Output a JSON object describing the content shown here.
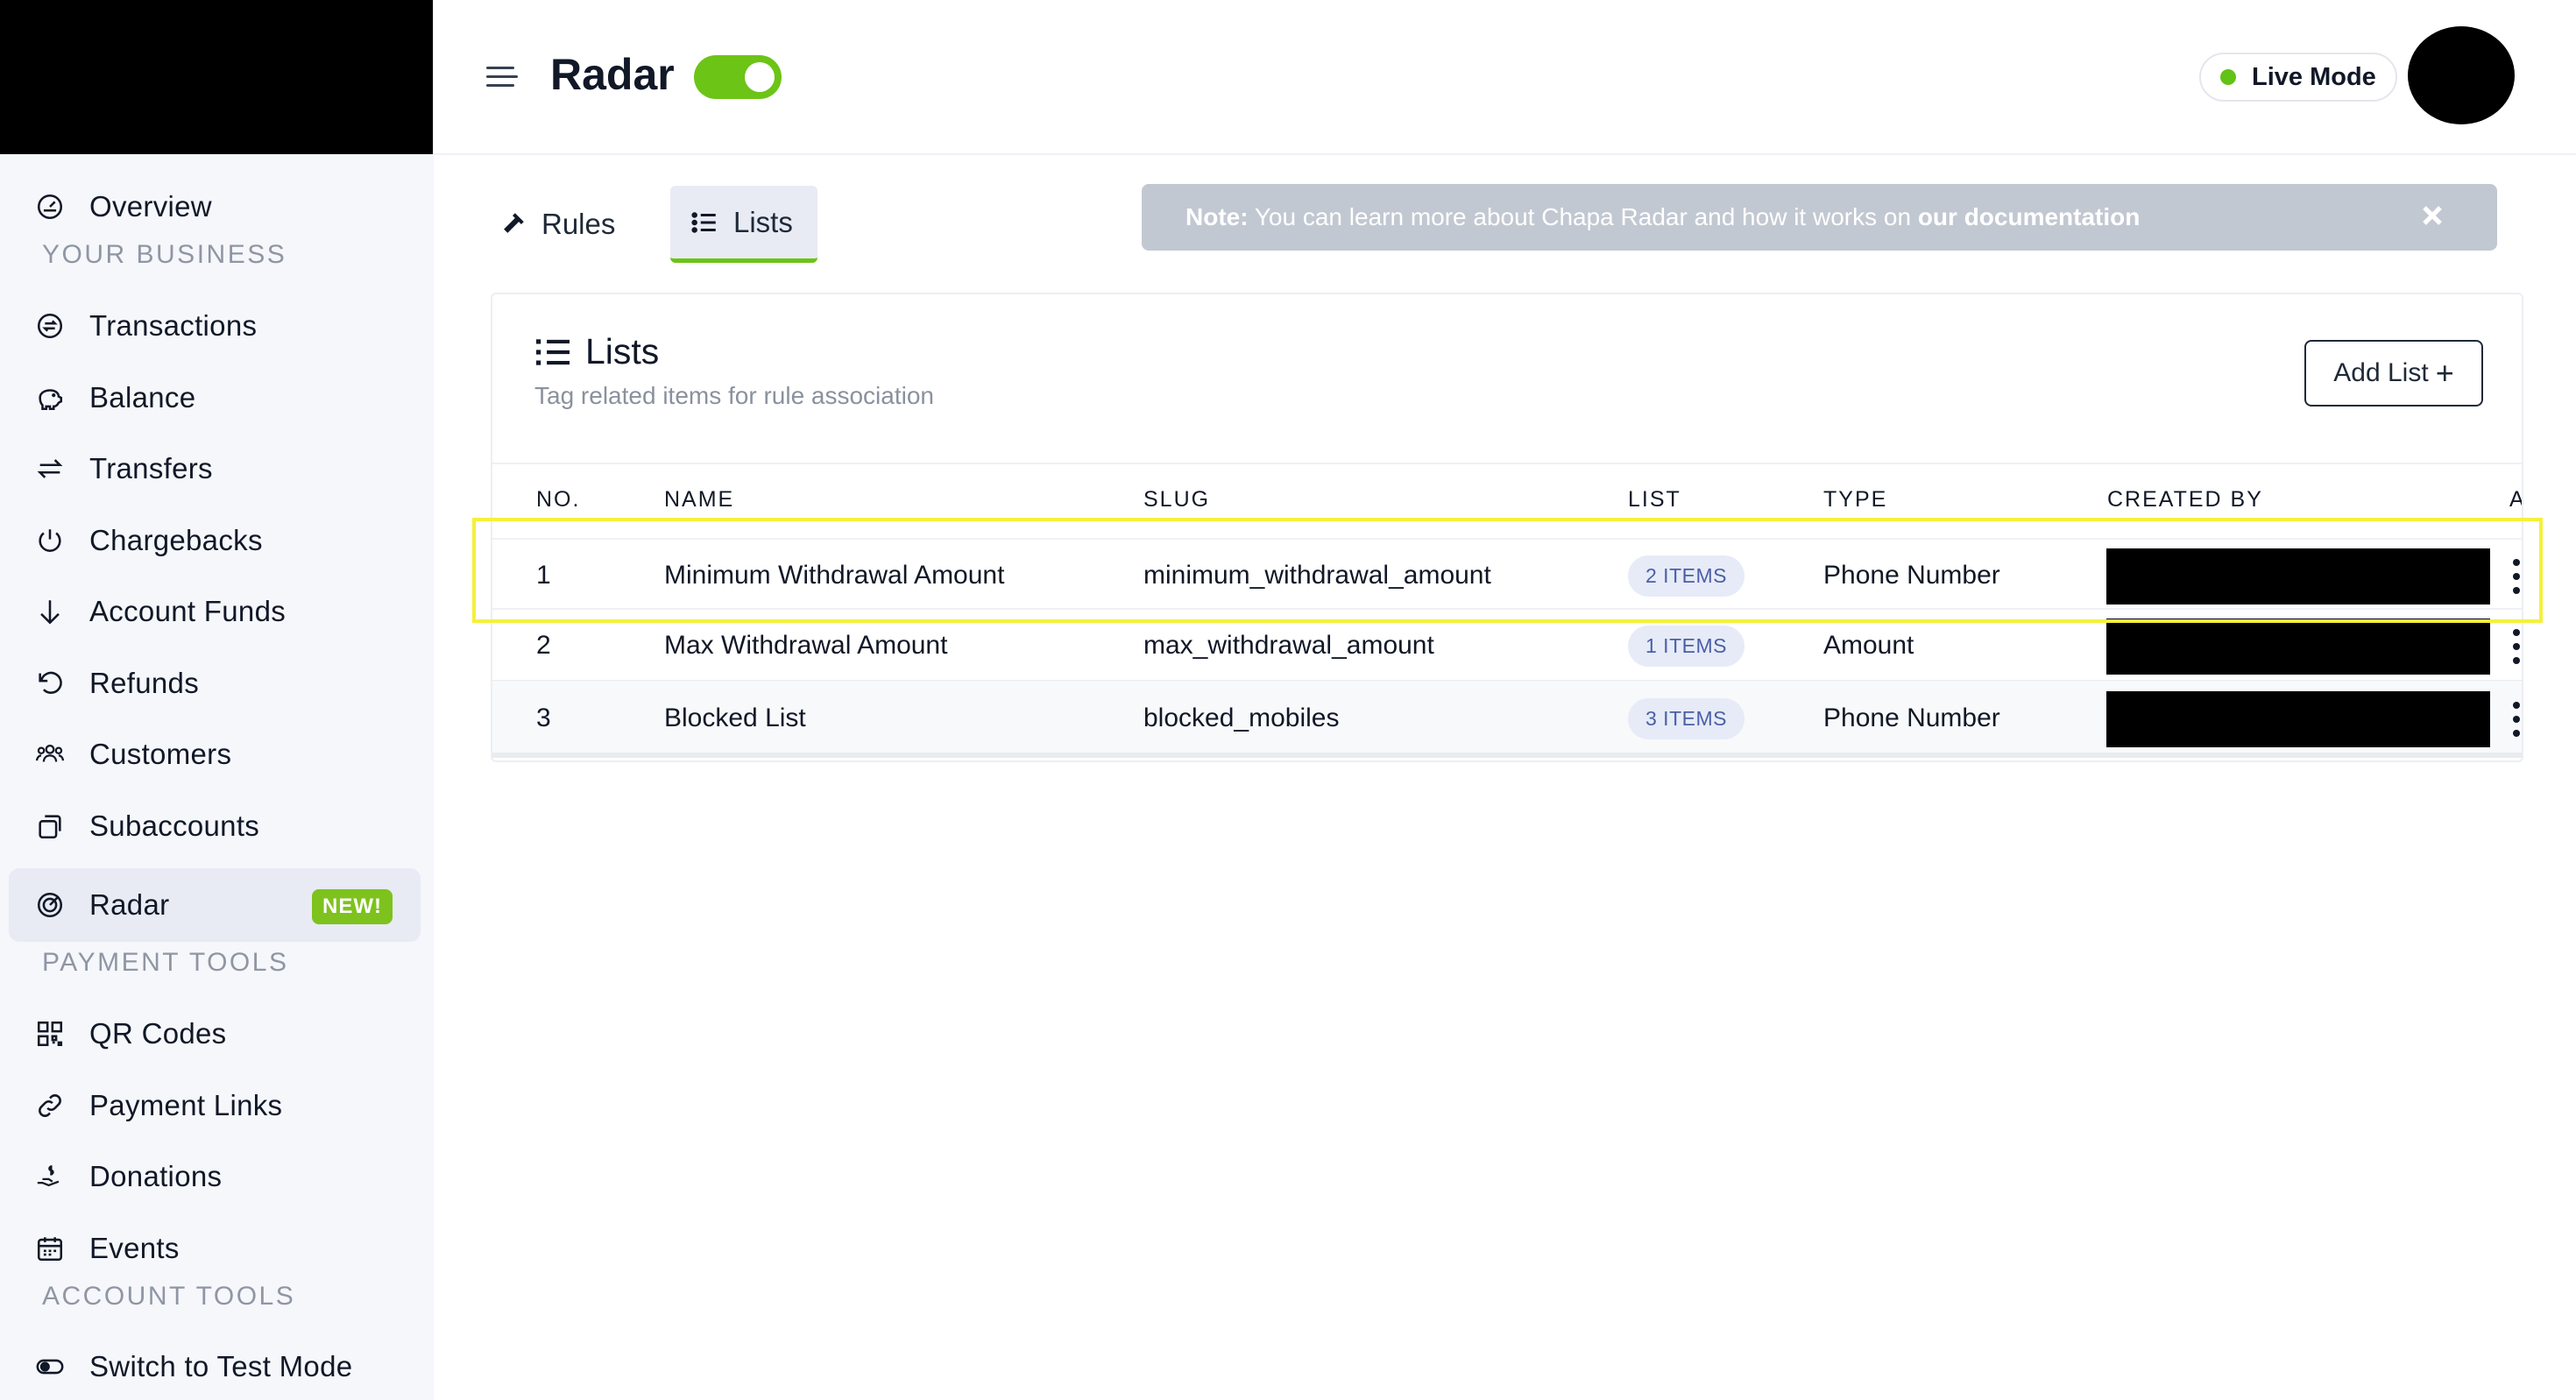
{
  "header": {
    "title": "Radar",
    "mode_label": "Live Mode",
    "toggle_on": true
  },
  "sidebar": {
    "top_items": [
      {
        "label": "Overview",
        "icon": "dashboard-gauge-icon"
      }
    ],
    "sections": [
      {
        "heading": "YOUR BUSINESS",
        "items": [
          {
            "label": "Transactions",
            "icon": "transactions-icon"
          },
          {
            "label": "Balance",
            "icon": "piggy-bank-icon"
          },
          {
            "label": "Transfers",
            "icon": "arrows-left-right-icon"
          },
          {
            "label": "Chargebacks",
            "icon": "power-icon"
          },
          {
            "label": "Account Funds",
            "icon": "arrow-down-icon"
          },
          {
            "label": "Refunds",
            "icon": "rotate-left-icon"
          },
          {
            "label": "Customers",
            "icon": "users-icon"
          },
          {
            "label": "Subaccounts",
            "icon": "stacked-cards-icon"
          },
          {
            "label": "Radar",
            "icon": "radar-icon",
            "badge": "NEW!",
            "active": true
          }
        ]
      },
      {
        "heading": "PAYMENT TOOLS",
        "items": [
          {
            "label": "QR Codes",
            "icon": "qr-code-icon"
          },
          {
            "label": "Payment Links",
            "icon": "link-icon"
          },
          {
            "label": "Donations",
            "icon": "donation-hand-icon"
          },
          {
            "label": "Events",
            "icon": "calendar-icon"
          }
        ]
      },
      {
        "heading": "ACCOUNT TOOLS",
        "items": [
          {
            "label": "Switch to Test Mode",
            "icon": "toggle-icon"
          }
        ]
      }
    ]
  },
  "tabs": [
    {
      "label": "Rules",
      "icon": "hammer-icon",
      "active": false
    },
    {
      "label": "Lists",
      "icon": "list-icon",
      "active": true
    }
  ],
  "note": {
    "prefix": "Note:",
    "text": " You can learn more about Chapa Radar and how it works on ",
    "link": "our documentation"
  },
  "card": {
    "title": "Lists",
    "subtitle": "Tag related items for rule association",
    "add_button": "Add List"
  },
  "table": {
    "columns": [
      "NO.",
      "NAME",
      "SLUG",
      "LIST",
      "TYPE",
      "CREATED BY",
      "A"
    ],
    "rows": [
      {
        "no": "1",
        "name": "Minimum Withdrawal Amount",
        "slug": "minimum_withdrawal_amount",
        "list": "2 ITEMS",
        "type": "Phone Number"
      },
      {
        "no": "2",
        "name": "Max Withdrawal Amount",
        "slug": "max_withdrawal_amount",
        "list": "1 ITEMS",
        "type": "Amount"
      },
      {
        "no": "3",
        "name": "Blocked List",
        "slug": "blocked_mobiles",
        "list": "3 ITEMS",
        "type": "Phone Number"
      }
    ]
  },
  "colors": {
    "accent_green": "#6cc417",
    "badge_bg": "#e6ebf7",
    "badge_text": "#4b5fa8",
    "note_bg": "#c2c8d2",
    "highlight": "#f5f03c"
  }
}
